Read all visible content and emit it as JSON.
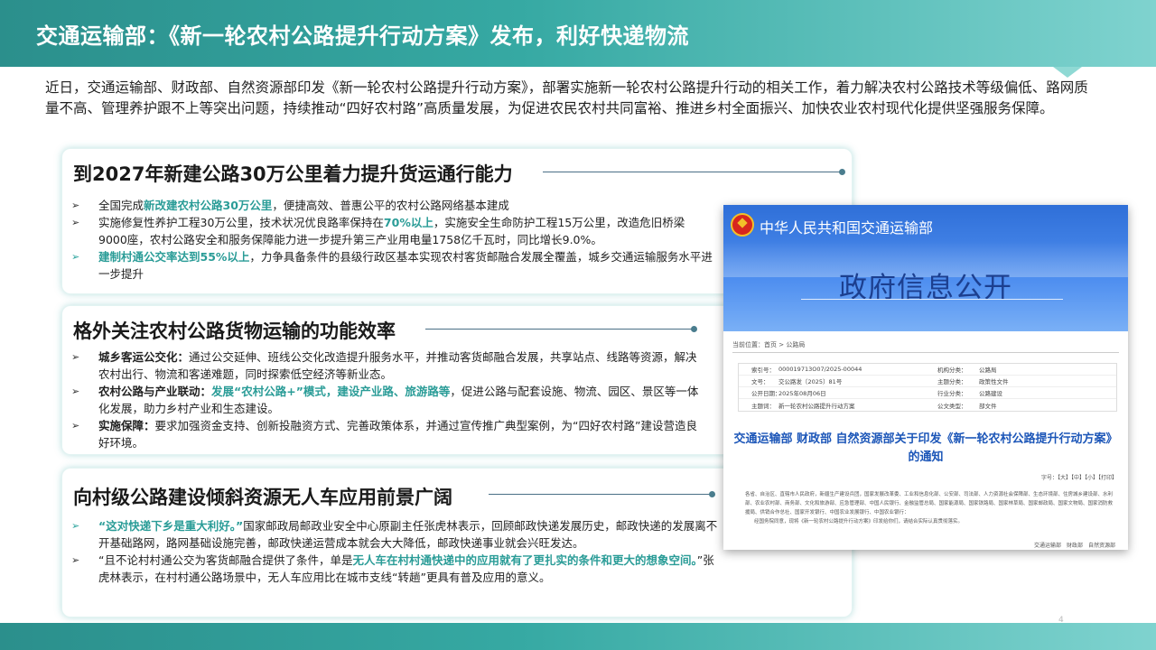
{
  "header": {
    "title": "交通运输部：《新一轮农村公路提升行动方案》发布，利好快递物流"
  },
  "intro": "近日，交通运输部、财政部、自然资源部印发《新一轮农村公路提升行动方案》，部署实施新一轮农村公路提升行动的相关工作，着力解决农村公路技术等级偏低、路网质量不高、管理养护跟不上等突出问题，持续推动“四好农村路”高质量发展，为促进农民农村共同富裕、推进乡村全面振兴、加快农业农村现代化提供坚强服务保障。",
  "cards": [
    {
      "title": "到2027年新建公路30万公里着力提升货运通行能力",
      "bullets": [
        {
          "prefix": "全国完成",
          "highlight": "新改建农村公路30万公里",
          "text": "，便捷高效、普惠公平的农村公路网络基本建成"
        },
        {
          "prefix": "实施修复性养护工程30万公里，技术状况优良路率保持在",
          "highlight": "70%以上",
          "text": "，实施安全生命防护工程15万公里，改造危旧桥梁9000座，农村公路安全和服务保障能力进一步提升第三产业用电量1758亿千瓦时，同比增长9.0%。"
        },
        {
          "prefix": "",
          "highlight": "建制村通公交率达到55%以上",
          "text": "，力争具备条件的县级行政区基本实现农村客货邮融合发展全覆盖，城乡交通运输服务水平进一步提升"
        }
      ]
    },
    {
      "title": "格外关注农村公路货物运输的功能效率",
      "bullets": [
        {
          "label": "城乡客运公交化：",
          "text": "通过公交延伸、班线公交化改造提升服务水平，并推动客货邮融合发展，共享站点、线路等资源，解决农村出行、物流和客递难题，同时探索低空经济等新业态。"
        },
        {
          "label": "农村公路与产业联动：",
          "highlight": "发展“农村公路+”模式，建设产业路、旅游路等",
          "text": "，促进公路与配套设施、物流、园区、景区等一体化发展，助力乡村产业和生态建设。"
        },
        {
          "label": "实施保障：",
          "text": "要求加强资金支持、创新投融资方式、完善政策体系，并通过宣传推广典型案例，为“四好农村路”建设营造良好环境。"
        }
      ]
    },
    {
      "title": "向村级公路建设倾斜资源无人车应用前景广阔",
      "bullets": [
        {
          "highlight": "“这对快递下乡是重大利好。”",
          "text": "国家邮政局邮政业安全中心原副主任张虎林表示，回顾邮政快递发展历史，邮政快递的发展离不开基础路网，路网基础设施完善，邮政快递运营成本就会大大降低，邮政快递事业就会兴旺发达。"
        },
        {
          "prefix": "“且不论村村通公交为客货邮融合提供了条件，单是",
          "highlight": "无人车在村村通快递中的应用就有了更扎实的条件和更大的想象空间。",
          "text": "”张虎林表示，在村村通公路场景中，无人车应用比在城市支线“转趟”更具有普及应用的意义。"
        }
      ]
    }
  ],
  "doc": {
    "ministry": "中华人民共和国交通运输部",
    "banner": "政府信息公开",
    "breadcrumb": "当前位置：首页 > 公路局",
    "meta": [
      {
        "k": "索引号：",
        "v": "000019713O07/2025-00044",
        "k2": "机构分类：",
        "v2": "公路局"
      },
      {
        "k": "文号：",
        "v": "交公路发〔2025〕81号",
        "k2": "主题分类：",
        "v2": "政策性文件"
      },
      {
        "k": "公开日期：",
        "v": "2025年08月06日",
        "k2": "行业分类：",
        "v2": "公路建设"
      },
      {
        "k": "主题词：",
        "v": "新一轮农村公路提升行动方案",
        "k2": "公文类型：",
        "v2": "部文件"
      }
    ],
    "title_line1": "交通运输部 财政部 自然资源部关于印发《新一轮农村公路提升行动方案》",
    "title_line2": "的通知",
    "tools": "字号：【大】【中】【小】【打印】",
    "body_line1": "各省、自治区、直辖市人民政府，新疆生产建设兵团，国家发展改革委、工业和信息化部、公安部、司法部、人力资源社会保障部、生态环境部、住房城乡建设部、水利部、农业农村部、商务部、文化和旅游部、应急管理部、中国人民银行、金融监管总局、国家能源局、国家铁路局、国家林草局、国家邮政局、国家文物局、国家消防救援局、供销合作总社、国家开发银行、中国农业发展银行、中国农业银行：",
    "body_line2": "经国务院同意，现将《新一轮农村公路提升行动方案》印发给你们，请结合实际认真贯彻落实。",
    "signature": "交通运输部　财政部　自然资源部"
  },
  "footer": {
    "page_number": "4"
  },
  "colors": {
    "teal": "#36a9a3",
    "highlight": "#2a9c97",
    "doc_blue": "#2f6fd8"
  }
}
